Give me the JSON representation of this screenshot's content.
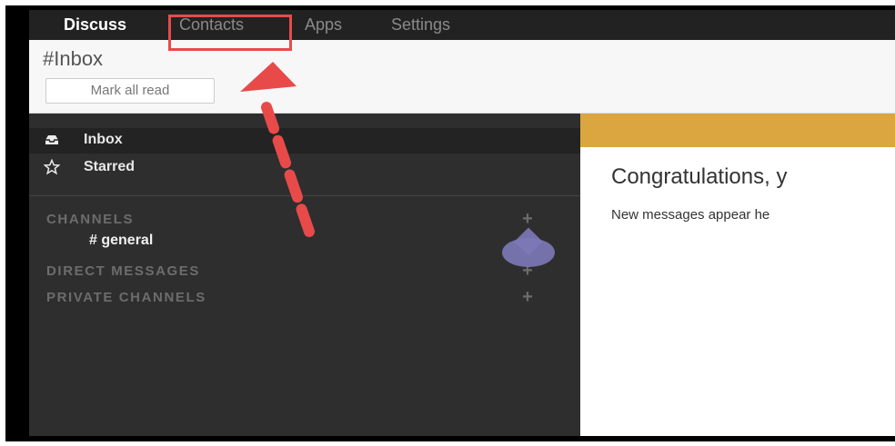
{
  "topnav": {
    "items": [
      {
        "label": "Discuss",
        "active": true
      },
      {
        "label": "Contacts",
        "active": false
      },
      {
        "label": "Apps",
        "active": false
      },
      {
        "label": "Settings",
        "active": false
      }
    ]
  },
  "control_panel": {
    "breadcrumb": "#Inbox",
    "mark_all_read_label": "Mark all read"
  },
  "sidebar": {
    "items": [
      {
        "label": "Inbox",
        "icon": "inbox-icon",
        "active": true
      },
      {
        "label": "Starred",
        "icon": "star-icon",
        "active": false
      }
    ],
    "sections": [
      {
        "label": "CHANNELS",
        "add_icon": "plus-icon"
      },
      {
        "label": "DIRECT MESSAGES",
        "add_icon": "plus-icon"
      },
      {
        "label": "PRIVATE CHANNELS",
        "add_icon": "plus-icon"
      }
    ],
    "channels": [
      {
        "label": "# general"
      }
    ]
  },
  "main": {
    "title": "Congratulations, y",
    "subtitle": "New messages appear he"
  },
  "colors": {
    "topnav_bg": "#222222",
    "sidebar_bg": "#2e2e2e",
    "banner": "#dba640",
    "annotation": "#e84a4a",
    "drop_marker": "#7d79b8"
  }
}
